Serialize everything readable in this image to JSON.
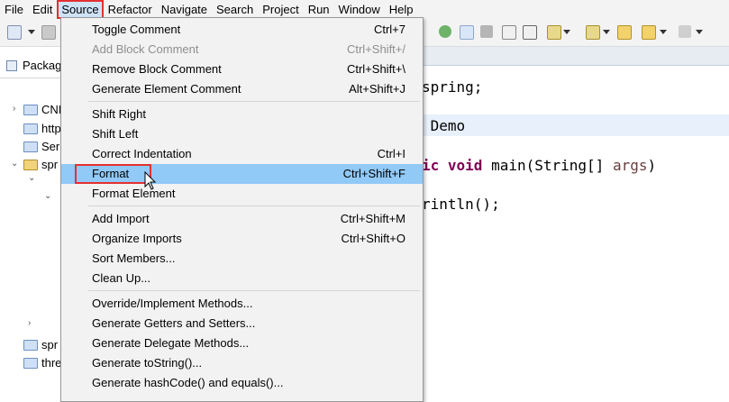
{
  "menubar": {
    "items": [
      "File",
      "Edit",
      "Source",
      "Refactor",
      "Navigate",
      "Search",
      "Project",
      "Run",
      "Window",
      "Help"
    ],
    "active": "Source"
  },
  "explorer": {
    "tab_label": "Packag",
    "rows": [
      "CNI",
      "http",
      "Ser",
      "spr",
      "spr",
      "thre"
    ]
  },
  "editor": {
    "lines": [
      {
        "plain": "spring;"
      },
      {
        "plain": " Demo"
      },
      {
        "kw1": "ic",
        "kw2": "void",
        "rest": " main(String[] ",
        "param": "args",
        "end": ")"
      },
      {
        "plain": "rintln();"
      }
    ]
  },
  "source_menu": {
    "groups": [
      [
        {
          "label": "Toggle Comment",
          "shortcut": "Ctrl+7",
          "enabled": true
        },
        {
          "label": "Add Block Comment",
          "shortcut": "Ctrl+Shift+/",
          "enabled": false
        },
        {
          "label": "Remove Block Comment",
          "shortcut": "Ctrl+Shift+\\",
          "enabled": true
        },
        {
          "label": "Generate Element Comment",
          "shortcut": "Alt+Shift+J",
          "enabled": true
        }
      ],
      [
        {
          "label": "Shift Right",
          "shortcut": "",
          "enabled": true
        },
        {
          "label": "Shift Left",
          "shortcut": "",
          "enabled": true
        },
        {
          "label": "Correct Indentation",
          "shortcut": "Ctrl+I",
          "enabled": true
        },
        {
          "label": "Format",
          "shortcut": "Ctrl+Shift+F",
          "enabled": true,
          "selected": true
        },
        {
          "label": "Format Element",
          "shortcut": "",
          "enabled": true
        }
      ],
      [
        {
          "label": "Add Import",
          "shortcut": "Ctrl+Shift+M",
          "enabled": true
        },
        {
          "label": "Organize Imports",
          "shortcut": "Ctrl+Shift+O",
          "enabled": true
        },
        {
          "label": "Sort Members...",
          "shortcut": "",
          "enabled": true
        },
        {
          "label": "Clean Up...",
          "shortcut": "",
          "enabled": true
        }
      ],
      [
        {
          "label": "Override/Implement Methods...",
          "shortcut": "",
          "enabled": true
        },
        {
          "label": "Generate Getters and Setters...",
          "shortcut": "",
          "enabled": true
        },
        {
          "label": "Generate Delegate Methods...",
          "shortcut": "",
          "enabled": true
        },
        {
          "label": "Generate toString()...",
          "shortcut": "",
          "enabled": true
        },
        {
          "label": "Generate hashCode() and equals()...",
          "shortcut": "",
          "enabled": true
        }
      ]
    ]
  },
  "colors": {
    "highlight_outline": "#e53030",
    "selected_item": "#91c9f7",
    "keyword": "#7f0055"
  }
}
